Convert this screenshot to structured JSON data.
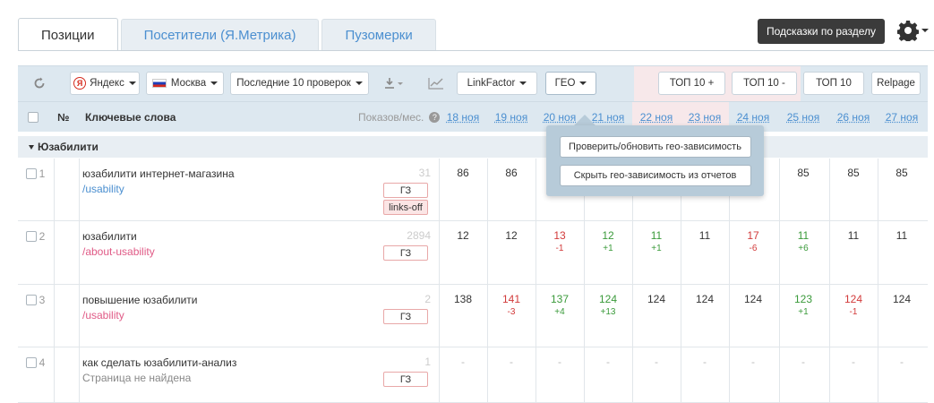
{
  "tabs": [
    {
      "label": "Позиции",
      "active": true
    },
    {
      "label": "Посетители (Я.Метрика)",
      "active": false
    },
    {
      "label": "Пузомерки",
      "active": false
    }
  ],
  "hint_button": "Подсказки по разделу",
  "toolbar": {
    "engine": "Яндекс",
    "region": "Москва",
    "period": "Последние 10 проверок",
    "linkfactor": "LinkFactor",
    "geo": "ГЕО",
    "top10plus": "ТОП 10 +",
    "top10minus": "ТОП 10 -",
    "top10": "ТОП 10",
    "relpage": "Relpage"
  },
  "header": {
    "num": "№",
    "keywords": "Ключевые слова",
    "shows": "Показов/мес.",
    "dates": [
      "18 ноя",
      "19 ноя",
      "20 ноя",
      "21 ноя",
      "22 ноя",
      "23 ноя",
      "24 ноя",
      "25 ноя",
      "26 ноя",
      "27 ноя"
    ]
  },
  "group": {
    "label": "Юзабилити"
  },
  "rows": [
    {
      "num": "1",
      "keyword": "юзабилити интернет-магазина",
      "url": "/usability",
      "shows": "31",
      "tags": [
        "ГЗ",
        "links-off"
      ],
      "positions": [
        {
          "v": "86",
          "d": ""
        },
        {
          "v": "86",
          "d": ""
        },
        {
          "v": "",
          "d": ""
        },
        {
          "v": "",
          "d": ""
        },
        {
          "v": "",
          "d": ""
        },
        {
          "v": "",
          "d": ""
        },
        {
          "v": "",
          "d": ""
        },
        {
          "v": "85",
          "d": ""
        },
        {
          "v": "85",
          "d": ""
        },
        {
          "v": "85",
          "d": ""
        }
      ]
    },
    {
      "num": "2",
      "keyword": "юзабилити",
      "url": "/about-usability",
      "shows": "2894",
      "tags": [
        "ГЗ"
      ],
      "positions": [
        {
          "v": "12",
          "d": ""
        },
        {
          "v": "12",
          "d": ""
        },
        {
          "v": "13",
          "d": "-1"
        },
        {
          "v": "12",
          "d": "+1"
        },
        {
          "v": "11",
          "d": "+1"
        },
        {
          "v": "11",
          "d": ""
        },
        {
          "v": "17",
          "d": "-6"
        },
        {
          "v": "11",
          "d": "+6"
        },
        {
          "v": "11",
          "d": ""
        },
        {
          "v": "11",
          "d": ""
        }
      ]
    },
    {
      "num": "3",
      "keyword": "повышение юзабилити",
      "url": "/usability",
      "shows": "2",
      "tags": [
        "ГЗ"
      ],
      "positions": [
        {
          "v": "138",
          "d": ""
        },
        {
          "v": "141",
          "d": "-3"
        },
        {
          "v": "137",
          "d": "+4"
        },
        {
          "v": "124",
          "d": "+13"
        },
        {
          "v": "124",
          "d": ""
        },
        {
          "v": "124",
          "d": ""
        },
        {
          "v": "124",
          "d": ""
        },
        {
          "v": "123",
          "d": "+1"
        },
        {
          "v": "124",
          "d": "-1"
        },
        {
          "v": "124",
          "d": ""
        }
      ]
    },
    {
      "num": "4",
      "keyword": "как сделать юзабилити-анализ",
      "url": "Страница не найдена",
      "shows": "1",
      "tags": [
        "ГЗ"
      ],
      "positions": [
        {
          "v": "-",
          "d": ""
        },
        {
          "v": "-",
          "d": ""
        },
        {
          "v": "-",
          "d": ""
        },
        {
          "v": "-",
          "d": ""
        },
        {
          "v": "-",
          "d": ""
        },
        {
          "v": "-",
          "d": ""
        },
        {
          "v": "-",
          "d": ""
        },
        {
          "v": "-",
          "d": ""
        },
        {
          "v": "-",
          "d": ""
        },
        {
          "v": "-",
          "d": ""
        }
      ]
    }
  ],
  "geo_popup": {
    "check": "Проверить/обновить гео-зависимость",
    "hide": "Скрыть гео-зависимость из отчетов"
  }
}
